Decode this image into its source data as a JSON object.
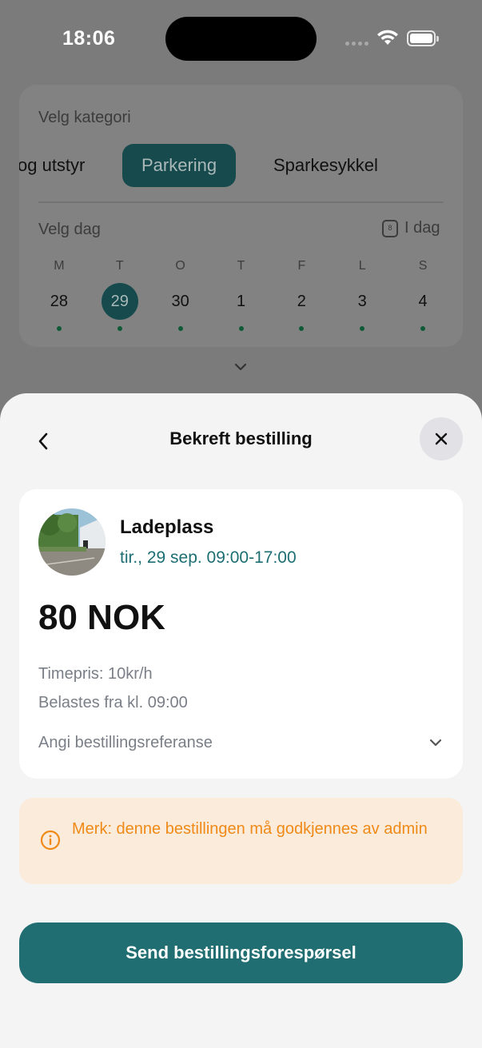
{
  "status_bar": {
    "time": "18:06"
  },
  "background": {
    "category_label": "Velg kategori",
    "categories": [
      {
        "label": "og utstyr",
        "active": false
      },
      {
        "label": "Parkering",
        "active": true
      },
      {
        "label": "Sparkesykkel",
        "active": false
      }
    ],
    "day_label": "Velg dag",
    "today_label": "I dag",
    "today_icon_number": "8",
    "week": [
      {
        "letter": "M",
        "number": "28",
        "selected": false
      },
      {
        "letter": "T",
        "number": "29",
        "selected": true
      },
      {
        "letter": "O",
        "number": "30",
        "selected": false
      },
      {
        "letter": "T",
        "number": "1",
        "selected": false
      },
      {
        "letter": "F",
        "number": "2",
        "selected": false
      },
      {
        "letter": "L",
        "number": "3",
        "selected": false
      },
      {
        "letter": "S",
        "number": "4",
        "selected": false
      }
    ]
  },
  "sheet": {
    "title": "Bekreft bestilling",
    "place_name": "Ladeplass",
    "booking_time": "tir., 29 sep. 09:00-17:00",
    "price": "80 NOK",
    "hourly_rate": "Timepris: 10kr/h",
    "charged_from": "Belastes fra kl. 09:00",
    "reference_label": "Angi bestillingsreferanse",
    "notice": "Merk: denne bestillingen må godkjennes av admin",
    "send_button": "Send bestillingsforespørsel"
  },
  "colors": {
    "accent": "#216e72",
    "accent_text": "#1c6e72",
    "notice_bg": "#fbebdb",
    "notice_text": "#ef8a18",
    "dot": "#0f5a36"
  },
  "icons": {
    "back": "chevron-left-icon",
    "close": "close-icon",
    "notice": "info-icon",
    "reference": "chevron-down-icon",
    "today": "calendar-icon"
  }
}
